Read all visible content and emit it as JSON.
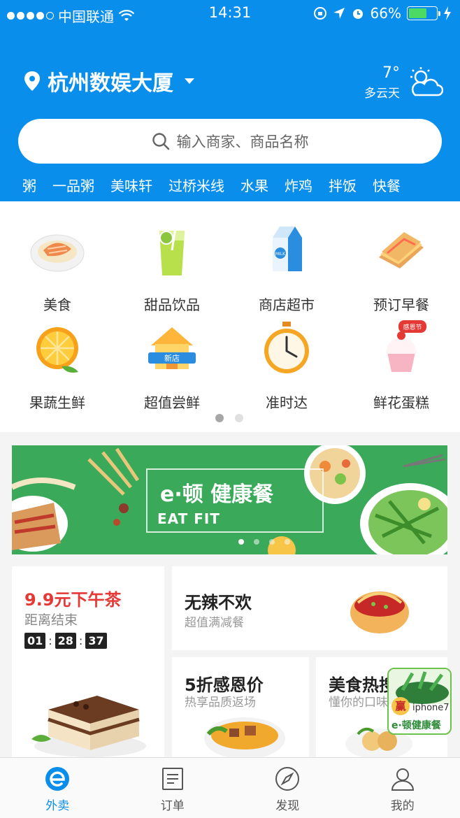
{
  "status": {
    "carrier": "中国联通",
    "time": "14:31",
    "battery": "66%",
    "battery_level": 0.66
  },
  "location": {
    "name": "杭州数娱大厦"
  },
  "weather": {
    "temp": "7°",
    "desc": "多云天"
  },
  "search": {
    "placeholder": "输入商家、商品名称"
  },
  "hot_keywords": [
    "粥",
    "一品粥",
    "美味轩",
    "过桥米线",
    "水果",
    "炸鸡",
    "拌饭",
    "快餐"
  ],
  "categories": [
    {
      "label": "美食",
      "icon": "food-plate-icon"
    },
    {
      "label": "甜品饮品",
      "icon": "drink-icon"
    },
    {
      "label": "商店超市",
      "icon": "milk-carton-icon"
    },
    {
      "label": "预订早餐",
      "icon": "sandwich-icon"
    },
    {
      "label": "果蔬生鲜",
      "icon": "orange-icon"
    },
    {
      "label": "超值尝鲜",
      "icon": "new-store-icon",
      "badge": "新店"
    },
    {
      "label": "准时达",
      "icon": "clock-icon"
    },
    {
      "label": "鲜花蛋糕",
      "icon": "cupcake-icon",
      "badge": "感恩节"
    }
  ],
  "banner": {
    "title": "e·顿 健康餐",
    "subtitle": "EAT FIT"
  },
  "promos": {
    "tea": {
      "title": "9.9元下午茶",
      "subtitle": "距离结束",
      "timer": [
        "01",
        "28",
        "37"
      ]
    },
    "spicy": {
      "title": "无辣不欢",
      "subtitle": "超值满减餐"
    },
    "discount": {
      "title": "5折感恩价",
      "subtitle": "热享品质返场"
    },
    "hot": {
      "title": "美食热搜",
      "subtitle": "懂你的口味"
    }
  },
  "floating_ad": {
    "badge": "赢",
    "line1": "iphone7",
    "line2": "e·顿健康餐"
  },
  "tabs": [
    {
      "label": "外卖",
      "icon": "takeaway-icon",
      "active": true
    },
    {
      "label": "订单",
      "icon": "order-icon",
      "active": false
    },
    {
      "label": "发现",
      "icon": "compass-icon",
      "active": false
    },
    {
      "label": "我的",
      "icon": "profile-icon",
      "active": false
    }
  ],
  "colors": {
    "brand": "#0a8eeb",
    "promo_red": "#e53935",
    "banner_green": "#3aa95a"
  }
}
